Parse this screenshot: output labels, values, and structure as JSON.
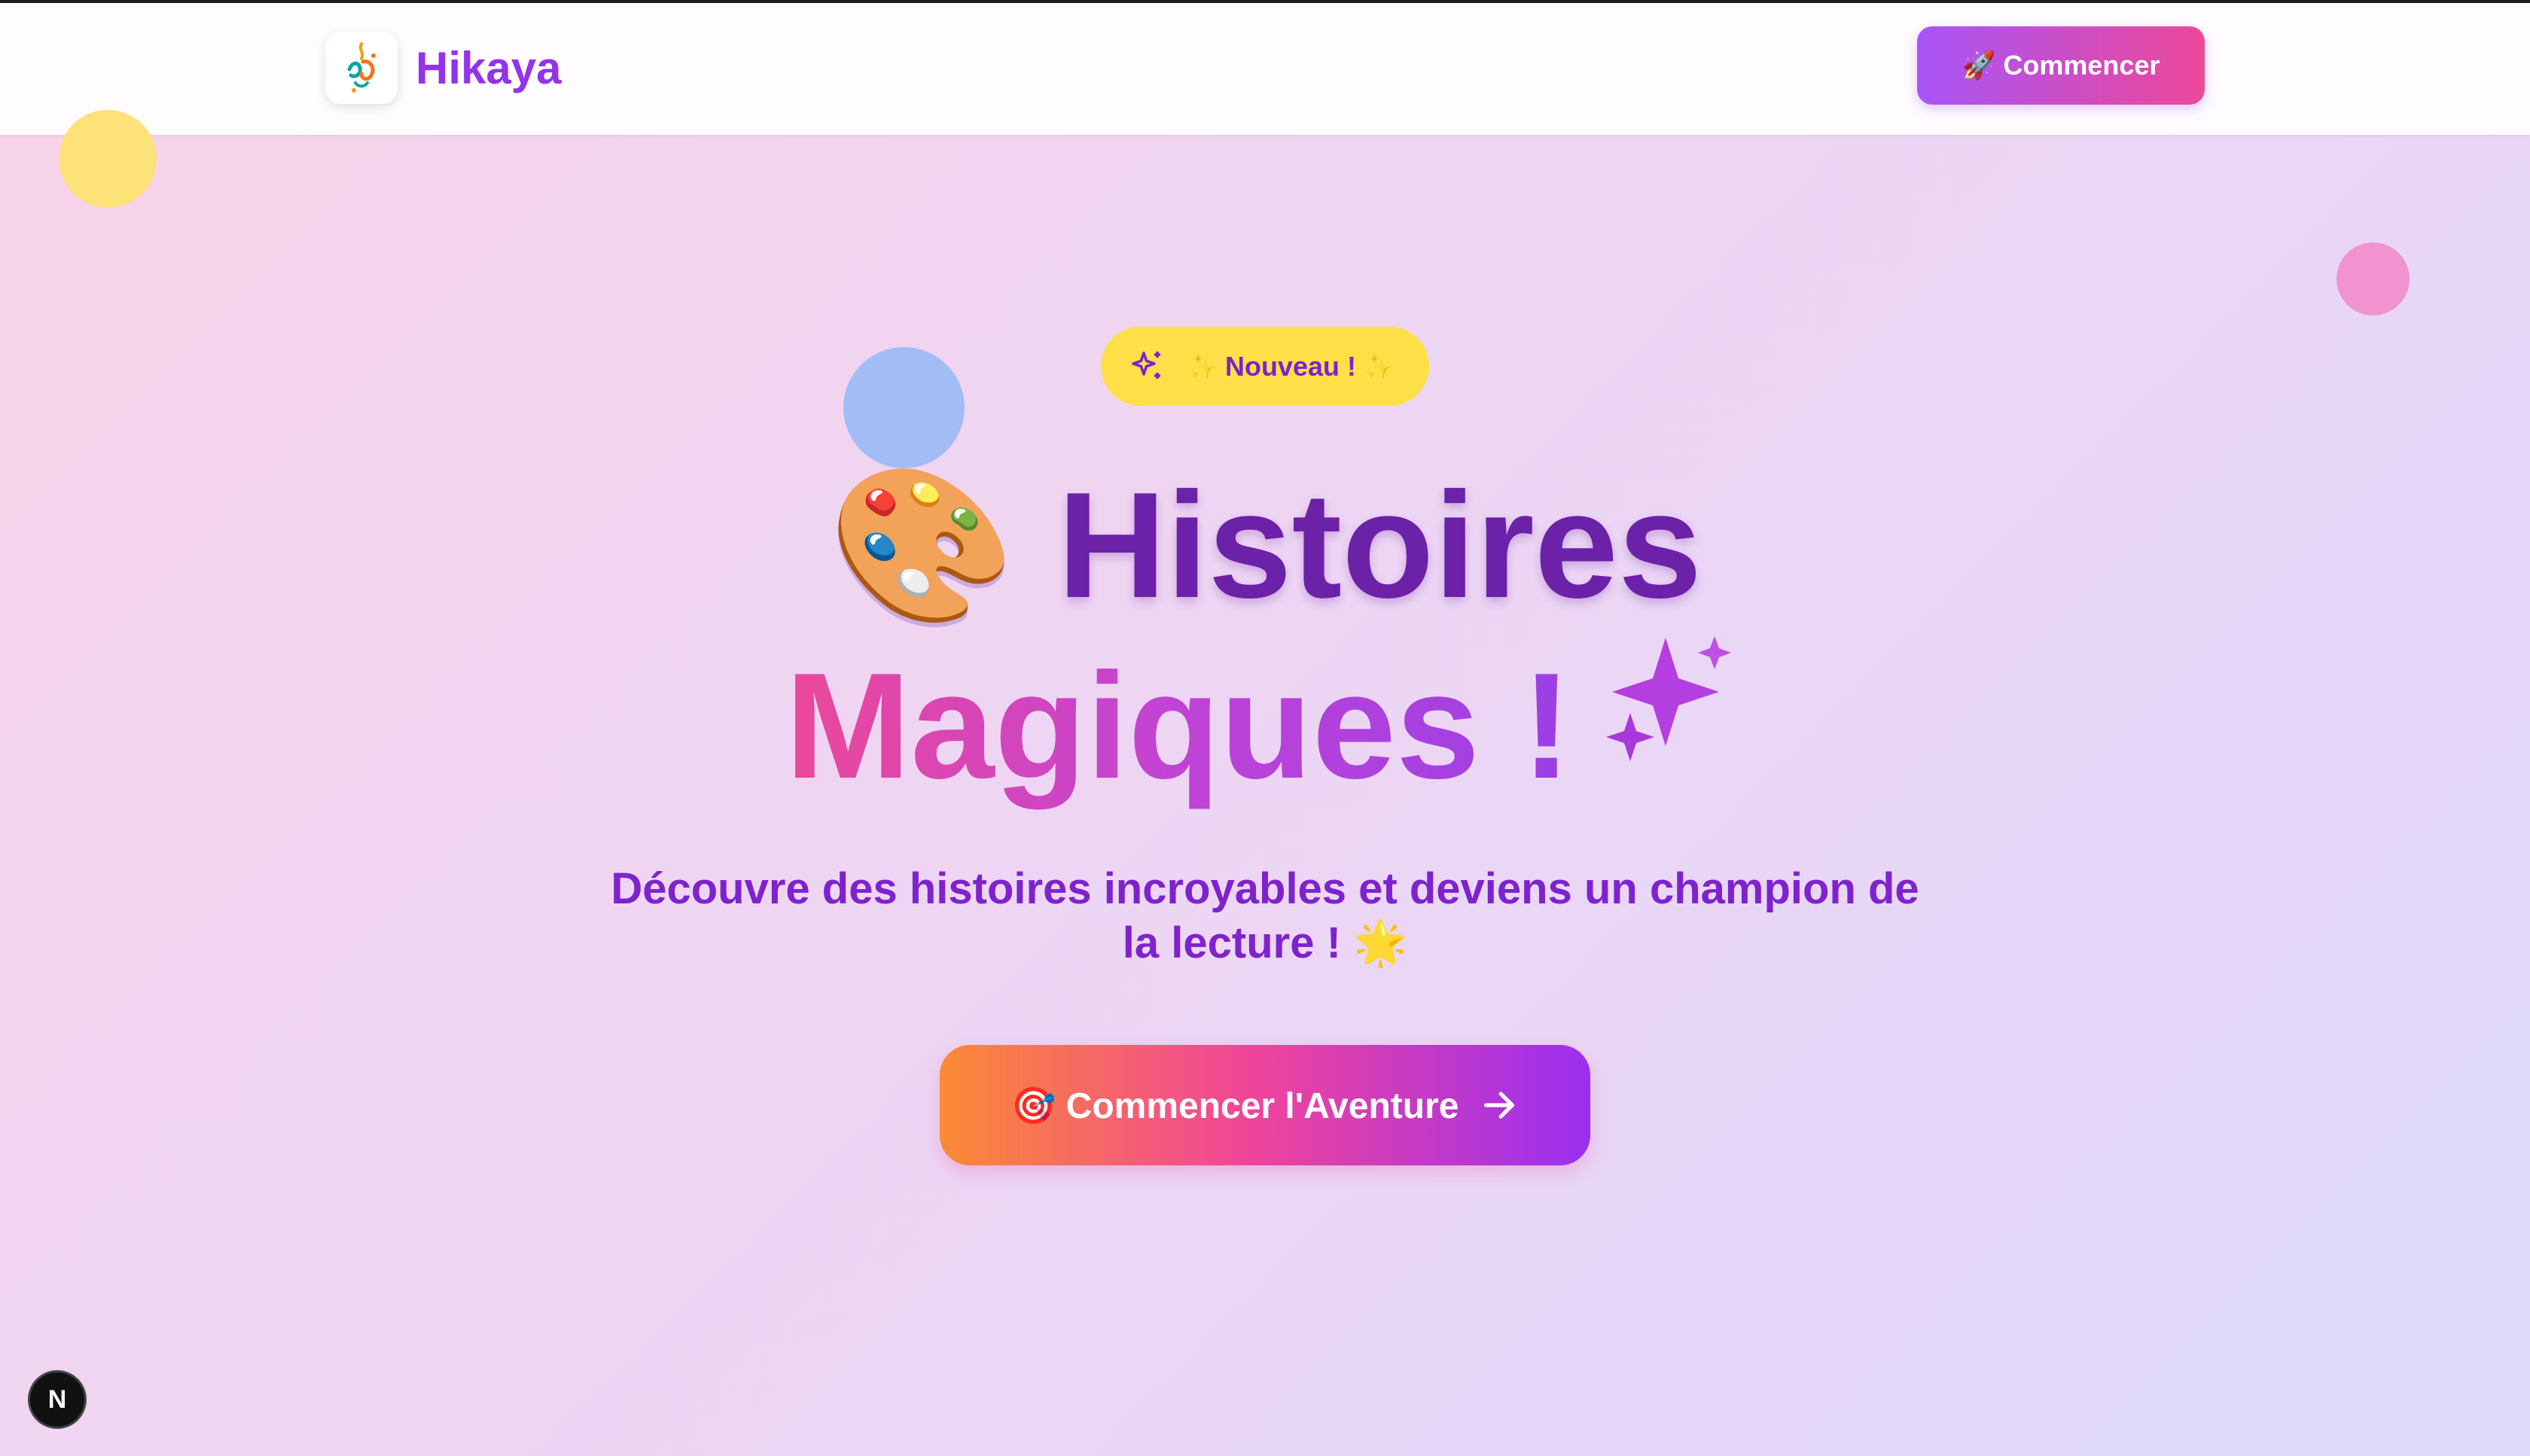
{
  "header": {
    "brand_name": "Hikaya",
    "logo_icon": "hikaya-calligraphy-logo",
    "start_button_label": "🚀 Commencer"
  },
  "hero": {
    "badge_icon": "sparkles-icon",
    "badge_label": "Nouveau !",
    "badge_sparkle_left": "✨",
    "badge_sparkle_right": "✨",
    "title_line1_emoji": "🎨",
    "title_line1": "Histoires",
    "title_line2": "Magiques !",
    "title_line2_emoji": "✨",
    "subtitle": "Découvre des histoires incroyables et deviens un champion de la lecture ! 🌟",
    "cta_label": "🎯 Commencer l'Aventure",
    "cta_icon": "arrow-right-icon"
  },
  "dev_indicator": {
    "label": "N"
  },
  "colors": {
    "brand_purple": "#9333ea",
    "title_purple": "#6b21a8",
    "badge_yellow": "#fde047",
    "pink": "#ec4899",
    "orange": "#fb8a34"
  }
}
